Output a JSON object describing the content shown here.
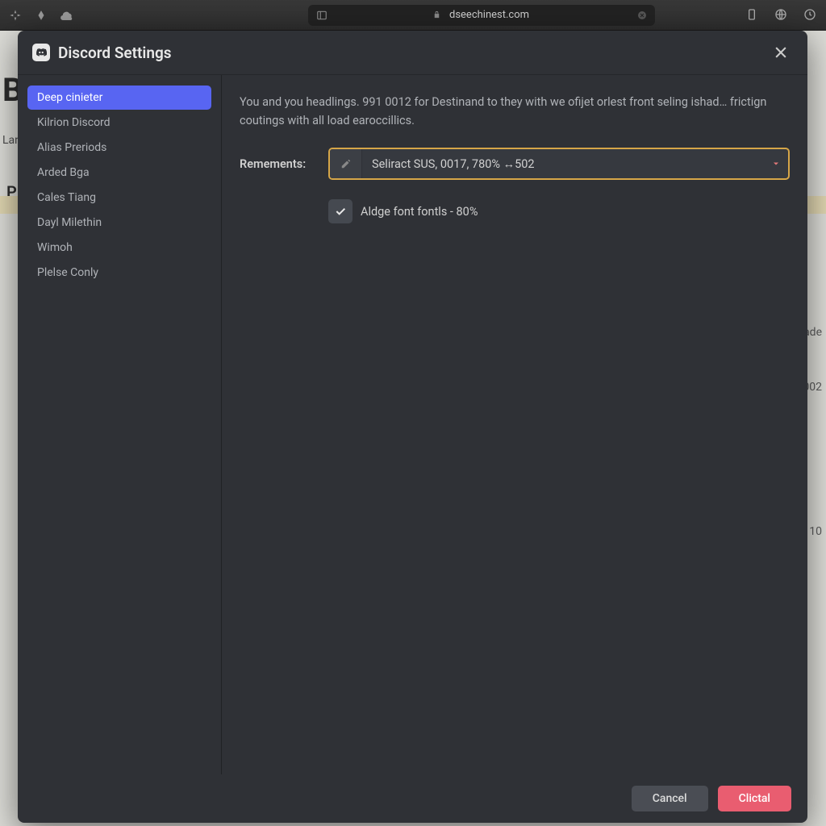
{
  "browser": {
    "url": "dseechinest.com"
  },
  "background": {
    "header_letter": "B",
    "sub_label": "Land",
    "p_label": "P",
    "right1": "ade",
    "right2": "002",
    "right3": "10"
  },
  "modal": {
    "title": "Discord Settings",
    "sidebar": {
      "items": [
        {
          "label": "Deep cinieter",
          "active": true
        },
        {
          "label": "Kilrion Discord",
          "active": false
        },
        {
          "label": "Alias Preriods",
          "active": false
        },
        {
          "label": "Arded Bga",
          "active": false
        },
        {
          "label": "Cales Tiang",
          "active": false
        },
        {
          "label": "Dayl Milethin",
          "active": false
        },
        {
          "label": "Wimoh",
          "active": false
        },
        {
          "label": "Plelse Conly",
          "active": false
        }
      ]
    },
    "description": "You and you headlings. 991 0012 for Destinand to they with we ofijet orlest front seling ishad… frictign coutings with all load earoccillics.",
    "form": {
      "label": "Remements:",
      "select_value": "Seliract SUS, 0017, 780% ↔502"
    },
    "checkbox": {
      "label": "Aldge font fontls - 80%",
      "checked": true
    },
    "footer": {
      "cancel": "Cancel",
      "confirm": "Clictal"
    }
  }
}
